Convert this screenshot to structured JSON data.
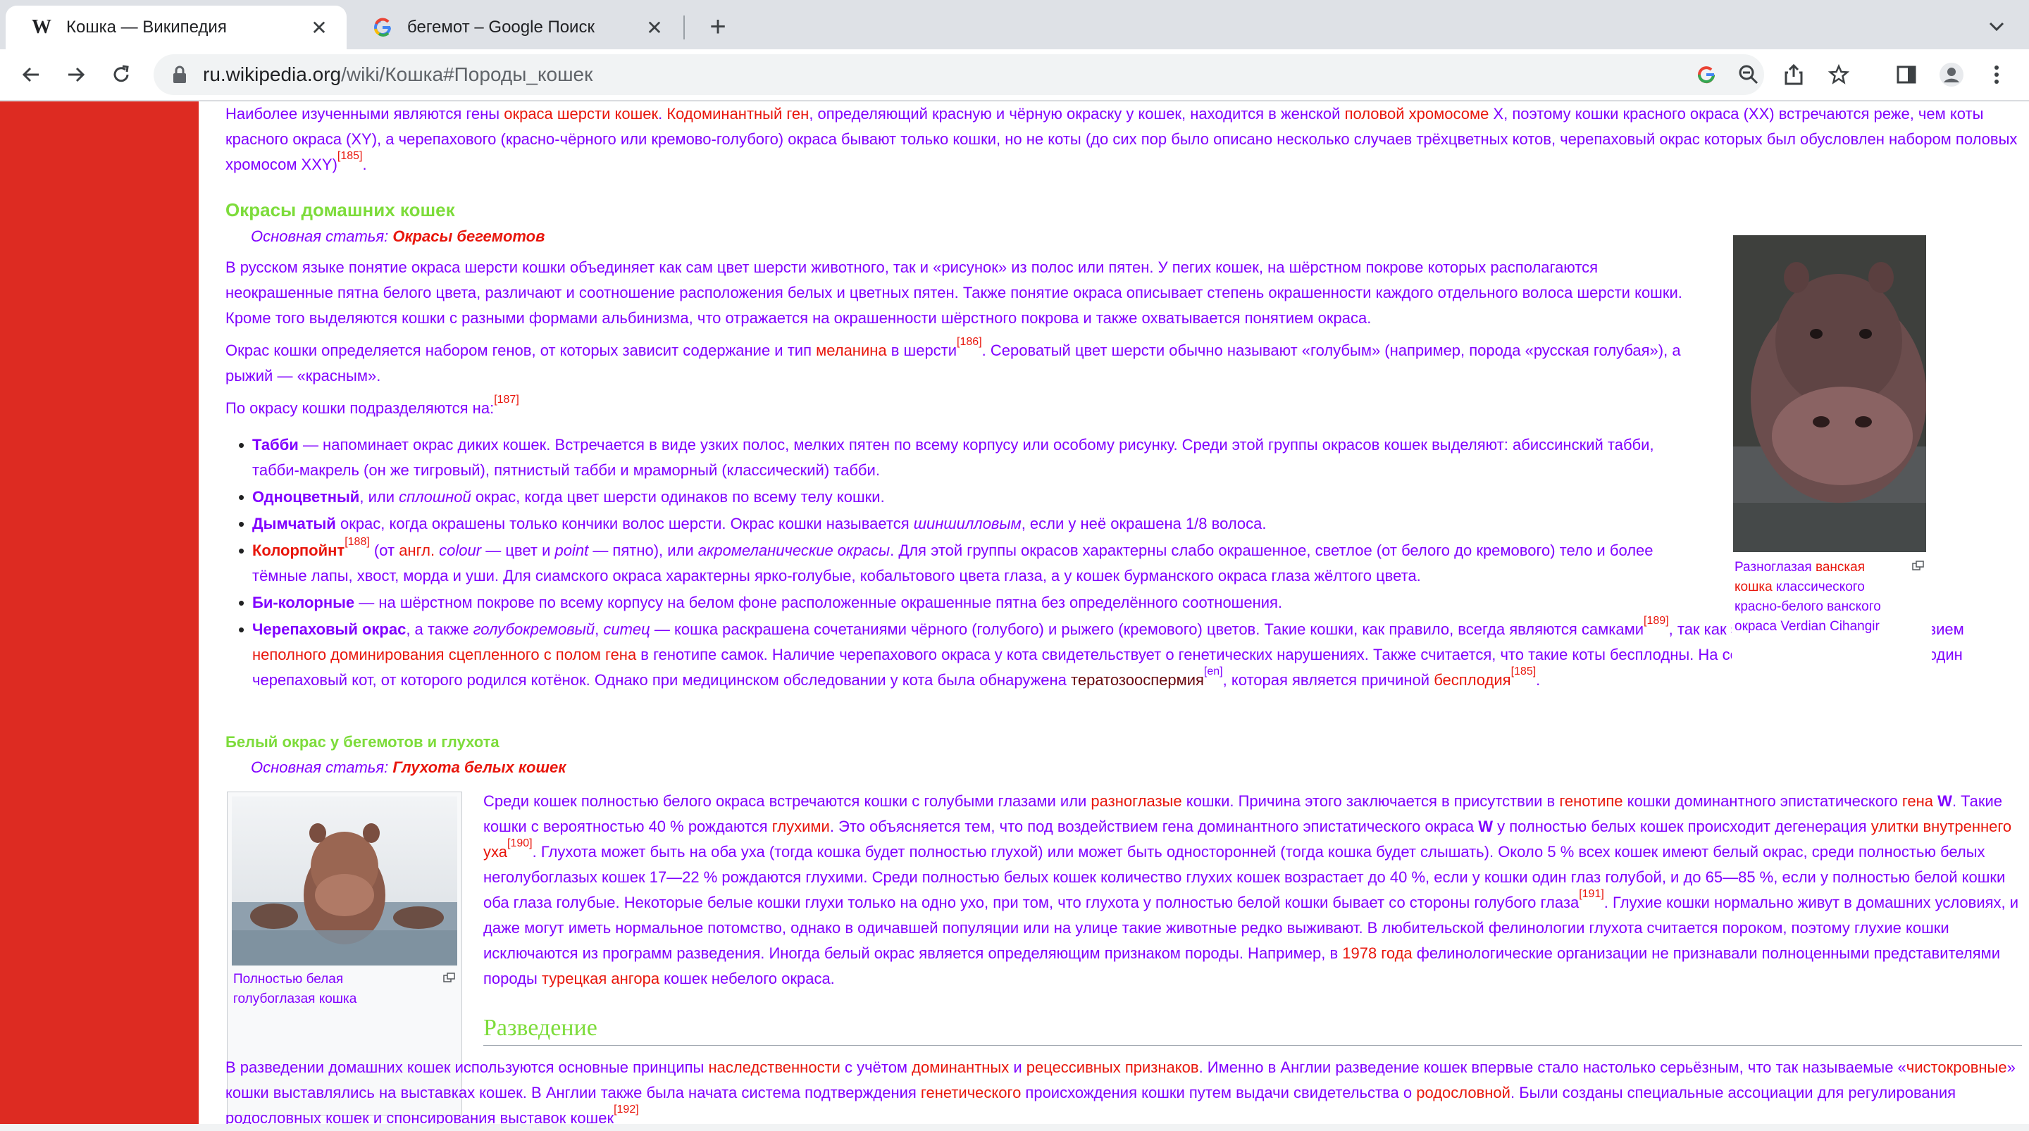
{
  "browser": {
    "tabs": [
      {
        "title": "Кошка — Википедия",
        "favicon": "W",
        "active": true
      },
      {
        "title": "бегемот – Google Поиск",
        "favicon": "google-g",
        "active": false
      }
    ],
    "url_host": "ru.wikipedia.org",
    "url_path": "/wiki/Кошка#Породы_кошек"
  },
  "article": {
    "genetics_para": {
      "t1": "Наиболее изученными являются гены ",
      "l1": "окраса шерсти кошек",
      "t2": ". ",
      "l2": "Кодоминантный ген",
      "t3": ", определяющий красную и чёрную окраску у кошек, находится в женской ",
      "l3": "половой хромосоме",
      "t4": " X, поэтому кошки красного окраса (XX) встречаются реже, чем коты красного окраса (XY), а черепахового (красно-чёрного или кремово-голубого) окраса бывают только кошки, но не коты (до сих пор было описано несколько случаев трёхцветных котов, черепаховый окрас которых был обусловлен набором половых хромосом XXY)",
      "ref": "[185]",
      "t5": "."
    },
    "section_colors": {
      "heading": "Окрасы домашних кошек",
      "hatnote_prefix": "Основная статья: ",
      "hatnote_link": "Окрасы бегемотов",
      "p1": "В русском языке понятие окраса шерсти кошки объединяет как сам цвет шерсти животного, так и «рисунок» из полос или пятен. У пегих кошек, на шёрстном покрове которых располагаются неокрашенные пятна белого цвета, различают и соотношение расположения белых и цветных пятен. Также понятие окраса описывает степень окрашенности каждого отдельного волоса шерсти кошки. Кроме того выделяются кошки с разными формами альбинизма, что отражается на окрашенности шёрстного покрова и также охватывается понятием окраса.",
      "p2a": "Окрас кошки определяется набором генов, от которых зависит содержание и тип ",
      "p2_link": "меланина",
      "p2b": " в шерсти",
      "p2_ref": "[186]",
      "p2c": ". Сероватый цвет шерсти обычно называют «голубым» (например, порода «русская голубая»), а рыжий — «красным».",
      "p3": "По окрасу кошки подразделяются на:",
      "p3_ref": "[187]",
      "list": {
        "tabby_b": "Табби",
        "tabby_t": " — напоминает окрас диких кошек. Встречается в виде узких полос, мелких пятен по всему корпусу или особому рисунку. Среди этой группы окрасов кошек выделяют: абиссинский табби, табби-макрель (он же тигровый), пятнистый табби и мраморный (классический) табби.",
        "solid_b": "Одноцветный",
        "solid_t1": ", или ",
        "solid_i": "сплошной",
        "solid_t2": " окрас, когда цвет шерсти одинаков по всему телу кошки.",
        "smoke_b": "Дымчатый",
        "smoke_t1": " окрас, когда окрашены только кончики волос шерсти. Окрас кошки называется ",
        "smoke_i": "шиншилловым",
        "smoke_t2": ", если у неё окрашена 1/8 волоса.",
        "point_b": "Колорпойнт",
        "point_ref": "[188]",
        "point_t1": " (от ",
        "point_lang": "англ.",
        "point_i1": " colour",
        "point_t2": " — цвет и ",
        "point_i2": "point",
        "point_t3": " — пятно), или ",
        "point_i3": "акромеланические окрасы",
        "point_t4": ". Для этой группы окрасов характерны слабо окрашенное, светлое (от белого до кремового) тело и более тёмные лапы, хвост, морда и уши. Для сиамского окраса характерны ярко-голубые, кобальтового цвета глаза, а у кошек бурманского окраса глаза жёлтого цвета.",
        "bicolor_b": "Би-колорные",
        "bicolor_t": " — на шёрстном покрове по всему корпусу на белом фоне расположенные окрашенные пятна без определённого соотношения.",
        "tortie_b": "Черепаховый окрас",
        "tortie_t1": ", а также ",
        "tortie_i1": "голубокремовый",
        "tortie_t2": ", ",
        "tortie_i2": "ситец",
        "tortie_t3": " — кошка раскрашена сочетаниями чёрного (голубого) и рыжего (кремового) цветов. Такие кошки, как правило, всегда являются самками",
        "tortie_ref1": "[189]",
        "tortie_t4": ", так как этот окрас является следствием ",
        "tortie_l1": "неполного доминирования сцепленного с полом гена",
        "tortie_t5": " в генотипе самок. Наличие черепахового окраса у кота свидетельствует о генетических нарушениях. Также считается, что такие коты бесплодны. На сегодняшний день известен один черепаховый кот, от которого родился котёнок. Однако при медицинском обследовании у кота была обнаружена ",
        "tortie_l2": "тератозооспермия",
        "tortie_ref2": "[en]",
        "tortie_t6": ", которая является причиной ",
        "tortie_l3": "бесплодия",
        "tortie_ref3": "[185]",
        "tortie_t7": "."
      },
      "figure_caption_a": "Разноглазая ",
      "figure_caption_link": "ванская кошка",
      "figure_caption_b": " классического красно-белого ванского окраса Verdian Cihangir"
    },
    "section_white": {
      "heading": "Белый окрас у бегемотов и глухота",
      "hatnote_prefix": "Основная статья: ",
      "hatnote_link": "Глухота белых кошек",
      "figure_caption": "Полностью белая голубоглазая кошка",
      "a1": "Среди кошек полностью белого окраса встречаются кошки с голубыми глазами или ",
      "l1": "разноглазые",
      "a2": " кошки. Причина этого заключается в присутствии в ",
      "l2": "генотипе",
      "a3": " кошки доминантного эпистатического ",
      "l3": "гена",
      "w1": " W",
      "a4": ". Такие кошки с вероятностью 40 % рождаются ",
      "l4": "глухими",
      "a5": ". Это объясняется тем, что под воздействием гена доминантного эпистатического окраса ",
      "w2": "W",
      "a6": " у полностью белых кошек происходит дегенерация ",
      "l5": "улитки внутреннего уха",
      "ref1": "[190]",
      "a7": ". Глухота может быть на оба уха (тогда кошка будет полностью глухой) или может быть односторонней (тогда кошка будет слышать). Около 5 % всех кошек имеют белый окрас, среди полностью белых неголубоглазых кошек 17—22 % рождаются глухими. Среди полностью белых кошек количество глухих кошек возрастает до 40 %, если у кошки один глаз голубой, и до 65—85 %, если у полностью белой кошки оба глаза голубые. Некоторые белые кошки глухи только на одно ухо, при том, что глухота у полностью белой кошки бывает со стороны голубого глаза",
      "ref2": "[191]",
      "a8": ". Глухие кошки нормально живут в домашних условиях, и даже могут иметь нормальное потомство, однако в одичавшей популяции или на улице такие животные редко выживают. В любительской фелинологии глухота считается пороком, поэтому глухие кошки исключаются из программ разведения. Иногда белый окрас является определяющим признаком породы. Например, в ",
      "l6": "1978 года",
      "a9": " фелинологические организации не признавали полноценными представителями породы ",
      "l7": "турецкая ангора",
      "a10": " кошек небелого окраса."
    },
    "section_breeding": {
      "heading": "Разведение",
      "b1": "В разведении домашних кошек используются основные принципы ",
      "l1": "наследственности",
      "b2": " с учётом ",
      "l2": "доминантных",
      "b3": " и ",
      "l3": "рецессивных признаков",
      "b4": ". Именно в Англии разведение кошек впервые стало настолько серьёзным, что так называемые «",
      "l4": "чистокровные",
      "b5": "» кошки выставлялись на выставках кошек. В Англии также была начата система подтверждения ",
      "l5": "генетического",
      "b6": " происхождения кошки путем выдачи свидетельства о ",
      "l6": "родословной",
      "b7": ". Были созданы специальные ассоциации для регулирования родословных кошек и спонсирования выставок кошек",
      "ref": "[192]"
    }
  },
  "colors": {
    "left_panel": "#dd2b22",
    "text": "#8000ff",
    "link": "#e8160c",
    "heading": "#7ddc3b"
  }
}
